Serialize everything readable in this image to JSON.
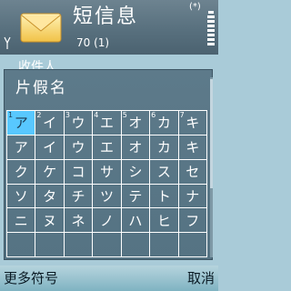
{
  "header": {
    "title": "短信息",
    "counter": "70 (1)",
    "bluetooth_indicator": "(*)",
    "app_icon": "envelope-icon",
    "signal_icon": "signal-antenna-icon",
    "battery_icon": "battery-level-icon"
  },
  "background_field": {
    "label": "收件人"
  },
  "dialog": {
    "title": "片假名",
    "cells": [
      {
        "char": "ア",
        "key": "1",
        "selected": true
      },
      {
        "char": "イ",
        "key": "2"
      },
      {
        "char": "ウ",
        "key": "3"
      },
      {
        "char": "エ",
        "key": "4"
      },
      {
        "char": "オ",
        "key": "5"
      },
      {
        "char": "カ",
        "key": "6"
      },
      {
        "char": "キ",
        "key": "7"
      },
      {
        "char": "ア"
      },
      {
        "char": "イ"
      },
      {
        "char": "ウ"
      },
      {
        "char": "エ"
      },
      {
        "char": "オ"
      },
      {
        "char": "カ"
      },
      {
        "char": "キ"
      },
      {
        "char": "ク"
      },
      {
        "char": "ケ"
      },
      {
        "char": "コ"
      },
      {
        "char": "サ"
      },
      {
        "char": "シ"
      },
      {
        "char": "ス"
      },
      {
        "char": "セ"
      },
      {
        "char": "ソ"
      },
      {
        "char": "タ"
      },
      {
        "char": "チ"
      },
      {
        "char": "ツ"
      },
      {
        "char": "テ"
      },
      {
        "char": "ト"
      },
      {
        "char": "ナ"
      },
      {
        "char": "ニ"
      },
      {
        "char": "ヌ"
      },
      {
        "char": "ネ"
      },
      {
        "char": "ノ"
      },
      {
        "char": "ハ"
      },
      {
        "char": "ヒ"
      },
      {
        "char": "フ"
      },
      {
        "char": ""
      },
      {
        "char": ""
      },
      {
        "char": ""
      },
      {
        "char": ""
      },
      {
        "char": ""
      },
      {
        "char": ""
      },
      {
        "char": ""
      }
    ]
  },
  "softkeys": {
    "left": "更多符号",
    "right": "取消"
  },
  "colors": {
    "selected_cell": "#58c8ff",
    "dialog_bg": "#5d7a8a",
    "softkey_bar": "#8fc0cf"
  }
}
